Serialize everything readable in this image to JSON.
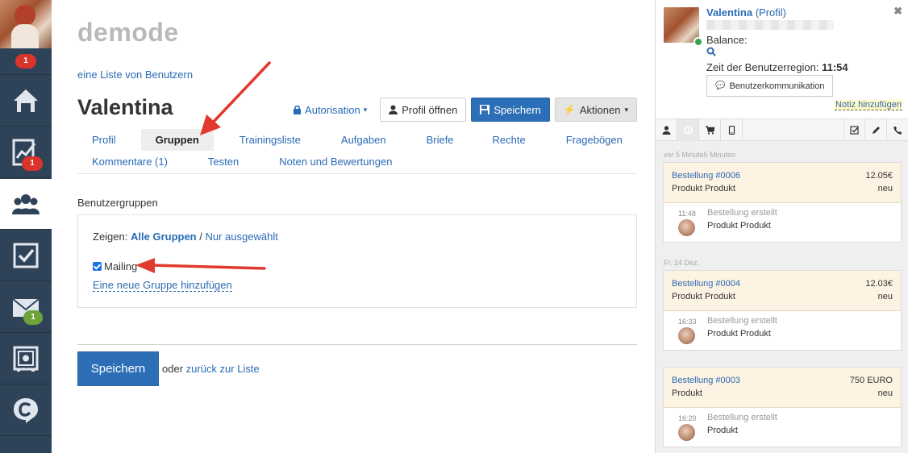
{
  "rail": {
    "top_badge": "1",
    "items": [
      {
        "name": "home",
        "icon": "home-icon",
        "badge": ""
      },
      {
        "name": "stats",
        "icon": "chart-icon",
        "badge": "1",
        "badge_color": "#d9342b"
      },
      {
        "name": "users",
        "icon": "users-icon",
        "badge": ""
      },
      {
        "name": "tasks",
        "icon": "checkbox-icon",
        "badge": ""
      },
      {
        "name": "mail",
        "icon": "envelope-icon",
        "badge": "1",
        "badge_color": "#6fa33a"
      },
      {
        "name": "safe",
        "icon": "safe-icon",
        "badge": ""
      },
      {
        "name": "chat",
        "icon": "chat-c-icon",
        "badge": ""
      }
    ]
  },
  "header": {
    "site_name": "demode",
    "breadcrumb": "eine Liste von Benutzern",
    "user_name": "Valentina"
  },
  "toolbar": {
    "authorization": "Autorisation",
    "open_profile": "Profil öffnen",
    "save": "Speichern",
    "actions": "Aktionen"
  },
  "tabs": {
    "row1": [
      "Profil",
      "Gruppen",
      "Trainingsliste",
      "Aufgaben",
      "Briefe",
      "Rechte",
      "Fragebögen"
    ],
    "row2": [
      "Kommentare (1)",
      "Testen",
      "Noten und Bewertungen"
    ],
    "active": "Gruppen"
  },
  "groups": {
    "section_title": "Benutzergruppen",
    "show_label": "Zeigen:",
    "show_all": "Alle Gruppen",
    "separator": "/",
    "show_selected": "Nur ausgewählt",
    "group_name": "Mailing",
    "add_group": "Eine neue Gruppe hinzufügen"
  },
  "footer": {
    "save": "Speichern",
    "or": "oder",
    "back": "zurück zur Liste"
  },
  "panel": {
    "name": "Valentina",
    "profile_link": "(Profil)",
    "balance_label": "Balance:",
    "time_label": "Zeit der Benutzerregion:",
    "time_value": "11:54",
    "communication": "Benutzerkommunikation",
    "add_note": "Notiz hinzufügen",
    "feed": [
      {
        "date": "vor 5 Minute5 Minuten",
        "order": "Bestellung #0006",
        "price": "12.05€",
        "product": "Produkt Produkt",
        "status": "neu",
        "time": "11:48",
        "event": "Bestellung erstellt",
        "event_product": "Produkt Produkt"
      },
      {
        "date": "Fr. 24 Dez.",
        "order": "Bestellung #0004",
        "price": "12.03€",
        "product": "Produkt Produkt",
        "status": "neu",
        "time": "16:33",
        "event": "Bestellung erstellt",
        "event_product": "Produkt Produkt"
      },
      {
        "date": "",
        "order": "Bestellung #0003",
        "price": "750 EURO",
        "product": "Produkt",
        "status": "neu",
        "time": "16:20",
        "event": "Bestellung erstellt",
        "event_product": "Produkt"
      }
    ]
  },
  "colors": {
    "rail_bg": "#2f4358",
    "primary": "#2d6fb6",
    "link": "#2a6ab4",
    "arrow": "#e03a2f",
    "order_head": "#fdf3e2"
  }
}
